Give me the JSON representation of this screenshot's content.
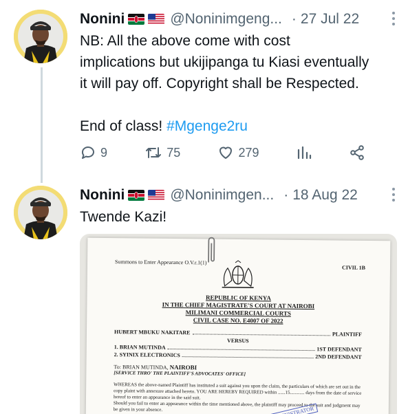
{
  "tweets": [
    {
      "name": "Nonini",
      "flags": [
        "kenya-flag",
        "usa-flag"
      ],
      "handle": "@Noninimgeng...",
      "separator": "·",
      "date": "27 Jul 22",
      "text_lines": [
        "NB: All the above come with cost",
        "implications but ukijipanga tu Kiasi eventually",
        "it will pay off. Copyright shall be Respected."
      ],
      "closing_text": "End of class! ",
      "hashtag": "#Mgenge2ru",
      "actions": {
        "replies": "9",
        "retweets": "75",
        "likes": "279"
      }
    },
    {
      "name": "Nonini",
      "flags": [
        "kenya-flag",
        "usa-flag"
      ],
      "handle": "@Noninimgen...",
      "separator": "·",
      "date": "18 Aug 22",
      "text": "Twende Kazi!"
    }
  ],
  "document": {
    "form_ref": "Summons to Enter Appearance O.V.r.1(1)",
    "civil": "CIVIL 1B",
    "republic": "REPUBLIC OF KENYA",
    "court": "IN THE CHIEF MAGISTRATE'S COURT AT NAIROBI",
    "division": "MILIMANI COMMERCIAL COURTS",
    "case_no": "CIVIL CASE NO. E4007 OF 2022",
    "plaintiff_name": "HUBERT MBUKU NAKITARE",
    "plaintiff_role": "PLAINTIFF",
    "versus": "VERSUS",
    "defendant1": "1. BRIAN MUTINDA",
    "defendant1_role": "1ST DEFENDANT",
    "defendant2": "2. SYINIX ELECTRONICS",
    "defendant2_role": "2ND DEFENDANT",
    "to_prefix": "To: BRIAN MUTINDA,",
    "to_city": "NAIROBI",
    "service": "[SERVICE THRO' THE PLAINTIFF'S ADVOCATES' OFFICE]",
    "para1": "WHEREAS the above-named Plaintiff has instituted a suit against you upon the claim, the particulars of which are set out in the copy plaint with annexure attached hereto. YOU ARE HEREBY REQUIRED within ......15............ days from the date of service hereof to enter an appearance in the said suit.",
    "para2": "Should you fail to enter an appearance within the time mentioned above, the plaintiff may proceed to the suit and judgment may be given in your absence.",
    "stamp": "ADMINISTRATOR"
  }
}
